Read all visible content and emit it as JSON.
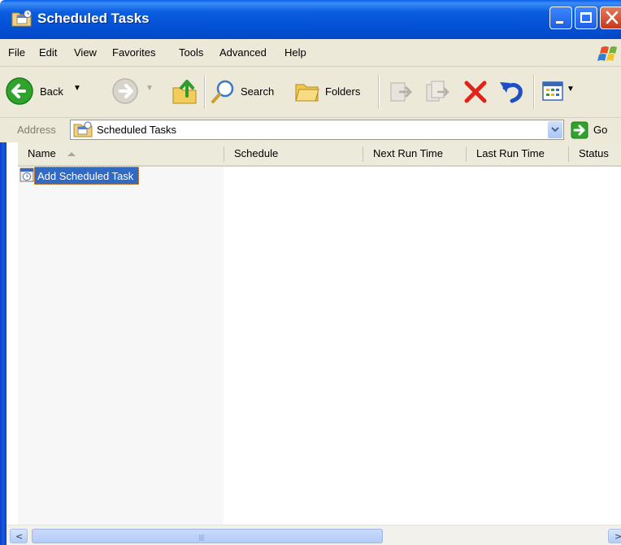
{
  "window": {
    "title": "Scheduled Tasks"
  },
  "menu": [
    "File",
    "Edit",
    "View",
    "Favorites",
    "Tools",
    "Advanced",
    "Help"
  ],
  "toolbar": {
    "back_label": "Back",
    "search_label": "Search",
    "folders_label": "Folders"
  },
  "address": {
    "label": "Address",
    "value": "Scheduled Tasks",
    "go_label": "Go"
  },
  "columns": [
    "Name",
    "Schedule",
    "Next Run Time",
    "Last Run Time",
    "Status"
  ],
  "items": [
    {
      "label": "Add Scheduled Task",
      "icon": "add-task-icon"
    }
  ],
  "colors": {
    "title_bar": "#0553d7",
    "selection": "#316ac5",
    "chrome": "#ece9d8"
  }
}
